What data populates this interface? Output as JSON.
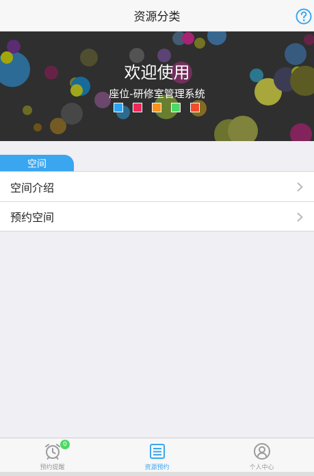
{
  "header": {
    "title": "资源分类",
    "help_icon": "question-circle-icon"
  },
  "banner": {
    "title": "欢迎使用",
    "subtitle": "座位-研修室管理系统",
    "indicator_colors": [
      "#2aa3f5",
      "#f0285a",
      "#f7931e",
      "#4cd964",
      "#f24a2c"
    ]
  },
  "section": {
    "tab_label": "空间",
    "items": [
      {
        "label": "空间介绍"
      },
      {
        "label": "预约空间"
      }
    ]
  },
  "tabbar": {
    "tabs": [
      {
        "label": "预约提醒",
        "icon": "alarm-clock-icon",
        "badge": "0",
        "active": false
      },
      {
        "label": "资源预约",
        "icon": "calendar-icon",
        "active": true
      },
      {
        "label": "个人中心",
        "icon": "user-circle-icon",
        "active": false
      }
    ]
  },
  "colors": {
    "accent": "#3aa6f0",
    "badge": "#4cd964"
  }
}
